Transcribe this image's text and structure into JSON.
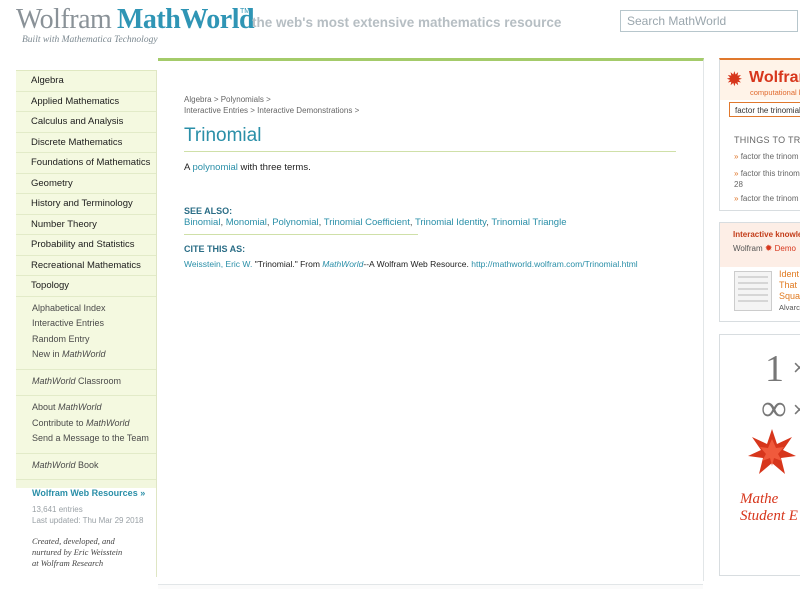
{
  "header": {
    "logo_wolfram": "Wolfram",
    "logo_mathworld": "MathWorld",
    "logo_tm": "TM",
    "logo_subtitle": "Built with Mathematica Technology",
    "tagline": "the web's most extensive mathematics resource",
    "search_placeholder": "Search MathWorld"
  },
  "nav": {
    "topics": [
      "Algebra",
      "Applied Mathematics",
      "Calculus and Analysis",
      "Discrete Mathematics",
      "Foundations of Mathematics",
      "Geometry",
      "History and Terminology",
      "Number Theory",
      "Probability and Statistics",
      "Recreational Mathematics",
      "Topology"
    ],
    "alphabetical_index": "Alphabetical Index",
    "interactive_entries": "Interactive Entries",
    "random_entry": "Random Entry",
    "new_in_prefix": "New in ",
    "mathworld": "MathWorld",
    "classroom_suffix": " Classroom",
    "about_prefix": "About ",
    "contribute_prefix": "Contribute to ",
    "send_message": "Send a Message to the Team",
    "book_suffix": " Book",
    "wolfram_web_resources": "Wolfram Web Resources »",
    "entries": "13,641 entries",
    "last_updated": "Last updated: Thu Mar 29 2018",
    "credit_line1": "Created, developed, and",
    "credit_line2": "nurtured by Eric Weisstein",
    "credit_line3": "at Wolfram Research"
  },
  "main": {
    "breadcrumb": {
      "algebra": "Algebra",
      "polynomials": "Polynomials",
      "interactive_entries": "Interactive Entries",
      "interactive_demonstrations": "Interactive Demonstrations",
      "sep": ">"
    },
    "title": "Trinomial",
    "definition": {
      "prefix": "A ",
      "link": "polynomial",
      "suffix": " with three terms."
    },
    "see_also_heading": "SEE ALSO:",
    "see_also": [
      "Binomial",
      "Monomial",
      "Polynomial",
      "Trinomial Coefficient",
      "Trinomial Identity",
      "Trinomial Triangle"
    ],
    "list_sep": ", ",
    "cite_heading": "CITE THIS AS:",
    "cite": {
      "author": "Weisstein, Eric W.",
      "text1": " \"Trinomial.\" From ",
      "mathworld": "MathWorld",
      "text2": "--A Wolfram Web Resource. ",
      "url": "http://mathworld.wolfram.com/Trinomial.html"
    }
  },
  "sidebar": {
    "wa": {
      "spike": "✹",
      "name": "Wolfram",
      "subtitle": "computational k",
      "input_value": "factor the trinomial",
      "things_heading": "THINGS TO TRY",
      "bullet": "»",
      "try1": "factor the trinom",
      "try2_line1": "factor this trinom",
      "try2_line2": "28",
      "try3": "factor the trinom"
    },
    "demo": {
      "heading": "Interactive knowled",
      "wolfram": "Wolfram",
      "spike": "✹",
      "demo_label": "Demo",
      "title_line1": "Ident",
      "title_line2": "That",
      "title_line3": "Squa",
      "author": "Alvarc"
    },
    "ad": {
      "one": "1",
      "times": "×",
      "inf": "∞",
      "line1": "Mathe",
      "line2": "Student E"
    }
  },
  "colors": {
    "accent_teal": "#2a8fa8",
    "nav_green": "#f2f7de",
    "rule_green": "#a4cb6a",
    "wolfram_red": "#d7361c",
    "wolfram_orange": "#e0782d"
  }
}
